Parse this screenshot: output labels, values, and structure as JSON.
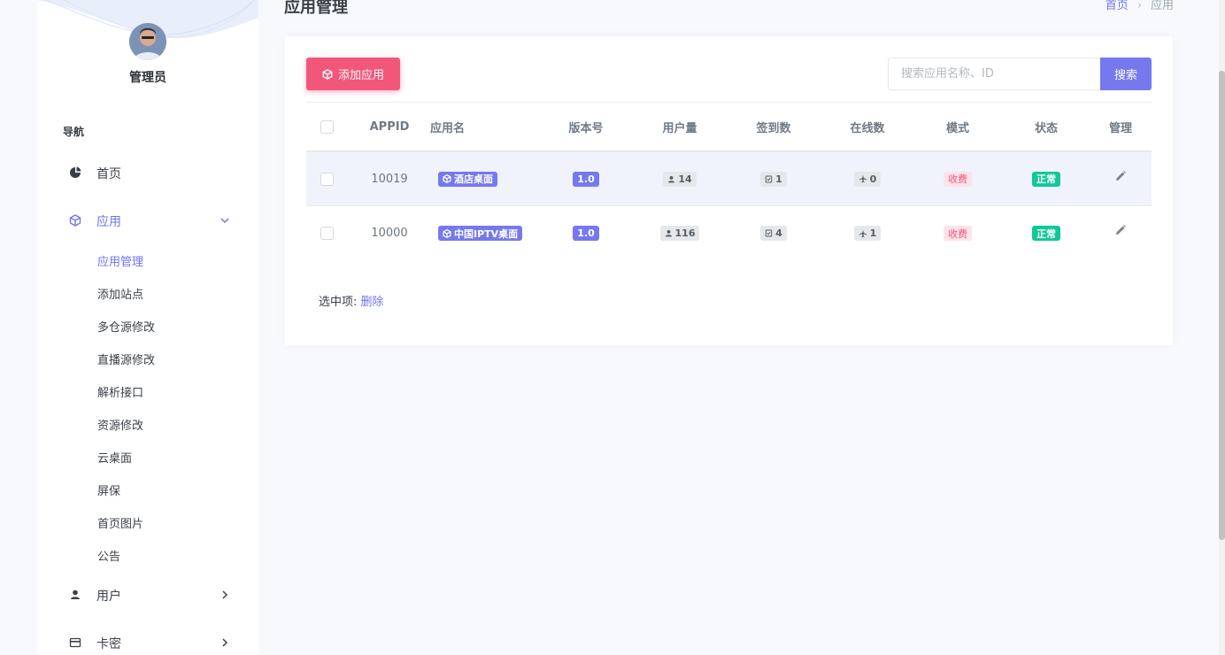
{
  "user": {
    "name": "管理员"
  },
  "nav": {
    "title": "导航",
    "items": [
      {
        "label": "首页",
        "icon": "dashboard-icon"
      },
      {
        "label": "应用",
        "icon": "cube-icon",
        "expanded": true
      },
      {
        "label": "用户",
        "icon": "user-icon"
      },
      {
        "label": "卡密",
        "icon": "card-icon"
      }
    ],
    "sub_items": [
      "应用管理",
      "添加站点",
      "多仓源修改",
      "直播源修改",
      "解析接口",
      "资源修改",
      "云桌面",
      "屏保",
      "首页图片",
      "公告"
    ],
    "active_sub": "应用管理"
  },
  "header": {
    "title": "应用管理",
    "breadcrumb": [
      "首页",
      "应用"
    ]
  },
  "toolbar": {
    "add_label": "添加应用",
    "search_placeholder": "搜索应用名称、ID",
    "search_label": "搜索"
  },
  "table": {
    "columns": [
      "APPID",
      "应用名",
      "版本号",
      "用户量",
      "签到数",
      "在线数",
      "模式",
      "状态",
      "管理"
    ],
    "rows": [
      {
        "appid": "10019",
        "name": "酒店桌面",
        "version": "1.0",
        "users": "14",
        "checkins": "1",
        "online": "0",
        "mode": "收费",
        "status": "正常"
      },
      {
        "appid": "10000",
        "name": "中国IPTV桌面",
        "version": "1.0",
        "users": "116",
        "checkins": "4",
        "online": "1",
        "mode": "收费",
        "status": "正常"
      }
    ]
  },
  "footer": {
    "selected_label": "选中项:",
    "delete_label": "删除"
  },
  "colors": {
    "accent": "#7679ee",
    "danger": "#f2577a",
    "success": "#10c89a"
  }
}
